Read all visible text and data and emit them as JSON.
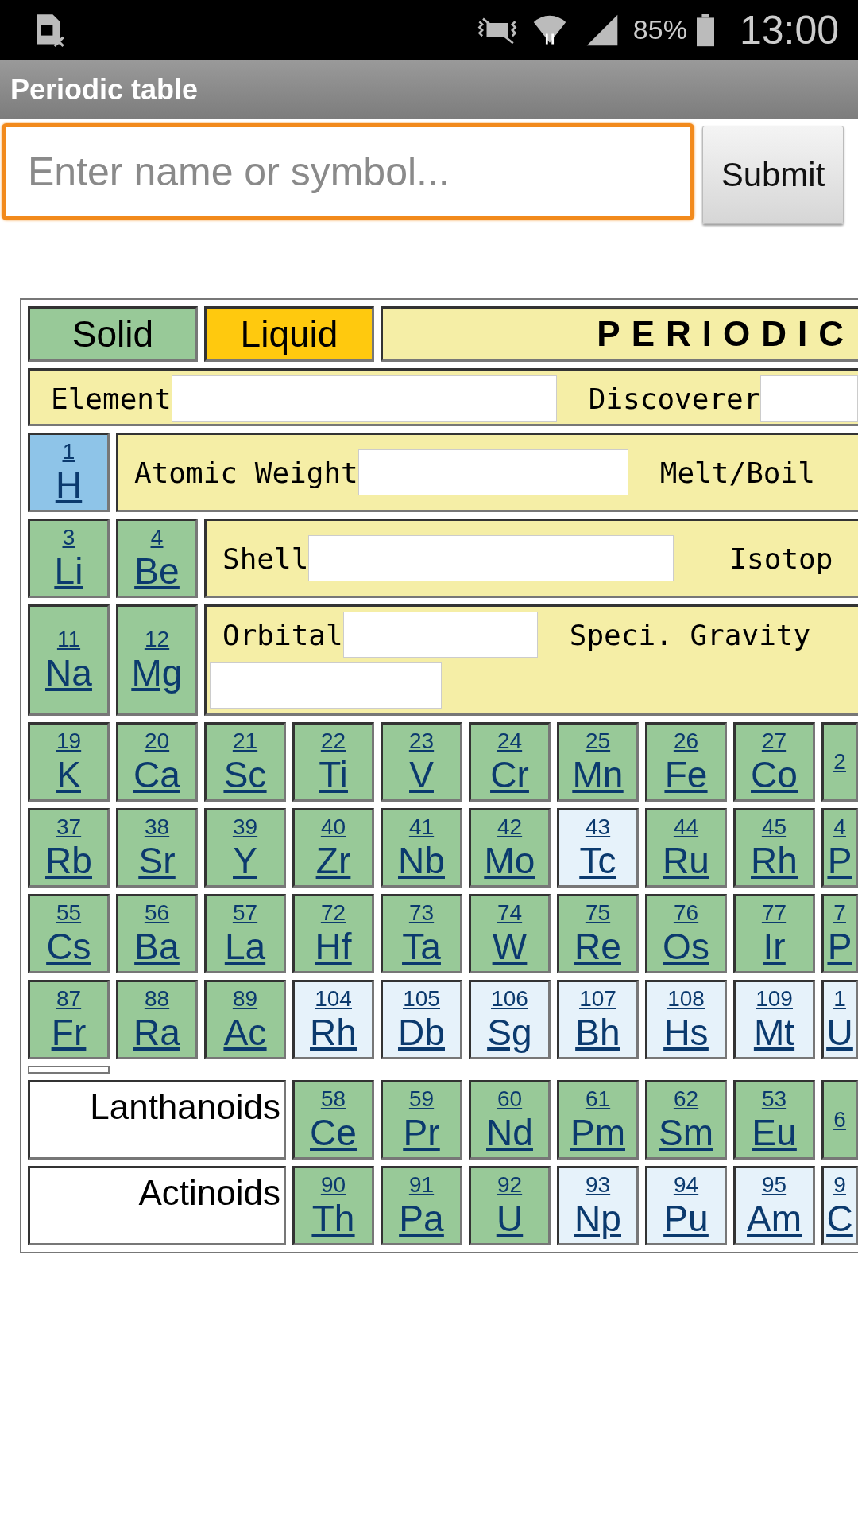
{
  "status_bar": {
    "battery": "85%",
    "time": "13:00"
  },
  "app_bar": {
    "title": "Periodic table"
  },
  "search": {
    "placeholder": "Enter name or symbol...",
    "focused": true,
    "button": "Submit"
  },
  "legend": [
    {
      "label": "Solid",
      "color": "#98c998"
    },
    {
      "label": "Liquid",
      "color": "#ffc90e"
    }
  ],
  "title": "PERIODIC",
  "top_rows": [
    {
      "elements": [],
      "panel": [
        {
          "kind": "label",
          "text": "Element"
        },
        {
          "kind": "field"
        },
        {
          "kind": "label",
          "text": "Discoverer"
        },
        {
          "kind": "field"
        }
      ]
    },
    {
      "elements": [
        {
          "number": "1",
          "symbol": "H",
          "color": "#8ec4e8"
        }
      ],
      "panel": [
        {
          "kind": "label",
          "text": "Atomic Weight"
        },
        {
          "kind": "field"
        },
        {
          "kind": "label",
          "text": "Melt/Boil"
        }
      ]
    },
    {
      "elements": [
        {
          "number": "3",
          "symbol": "Li",
          "color": "#98c998"
        },
        {
          "number": "4",
          "symbol": "Be",
          "color": "#98c998"
        }
      ],
      "panel": [
        {
          "kind": "label",
          "text": "Shell"
        },
        {
          "kind": "field"
        },
        {
          "kind": "label",
          "text": "Isotop"
        }
      ]
    },
    {
      "elements": [
        {
          "number": "11",
          "symbol": "Na",
          "color": "#98c998"
        },
        {
          "number": "12",
          "symbol": "Mg",
          "color": "#98c998"
        }
      ],
      "panel": [
        {
          "kind": "label",
          "text": "Orbital"
        },
        {
          "kind": "field"
        },
        {
          "kind": "label",
          "text": "Speci. Gravity"
        },
        {
          "kind": "field"
        }
      ]
    }
  ],
  "element_rows": [
    [
      {
        "number": "19",
        "symbol": "K",
        "color": "#98c998"
      },
      {
        "number": "20",
        "symbol": "Ca",
        "color": "#98c998"
      },
      {
        "number": "21",
        "symbol": "Sc",
        "color": "#98c998"
      },
      {
        "number": "22",
        "symbol": "Ti",
        "color": "#98c998"
      },
      {
        "number": "23",
        "symbol": "V",
        "color": "#98c998"
      },
      {
        "number": "24",
        "symbol": "Cr",
        "color": "#98c998"
      },
      {
        "number": "25",
        "symbol": "Mn",
        "color": "#98c998"
      },
      {
        "number": "26",
        "symbol": "Fe",
        "color": "#98c998"
      },
      {
        "number": "27",
        "symbol": "Co",
        "color": "#98c998"
      },
      {
        "number": "2",
        "color": "#98c998"
      }
    ],
    [
      {
        "number": "37",
        "symbol": "Rb",
        "color": "#98c998"
      },
      {
        "number": "38",
        "symbol": "Sr",
        "color": "#98c998"
      },
      {
        "number": "39",
        "symbol": "Y",
        "color": "#98c998"
      },
      {
        "number": "40",
        "symbol": "Zr",
        "color": "#98c998"
      },
      {
        "number": "41",
        "symbol": "Nb",
        "color": "#98c998"
      },
      {
        "number": "42",
        "symbol": "Mo",
        "color": "#98c998"
      },
      {
        "number": "43",
        "symbol": "Tc",
        "color": "#e6f2fa"
      },
      {
        "number": "44",
        "symbol": "Ru",
        "color": "#98c998"
      },
      {
        "number": "45",
        "symbol": "Rh",
        "color": "#98c998"
      },
      {
        "number": "4",
        "symbol": "P",
        "color": "#98c998"
      }
    ],
    [
      {
        "number": "55",
        "symbol": "Cs",
        "color": "#98c998"
      },
      {
        "number": "56",
        "symbol": "Ba",
        "color": "#98c998"
      },
      {
        "number": "57",
        "symbol": "La",
        "color": "#98c998"
      },
      {
        "number": "72",
        "symbol": "Hf",
        "color": "#98c998"
      },
      {
        "number": "73",
        "symbol": "Ta",
        "color": "#98c998"
      },
      {
        "number": "74",
        "symbol": "W",
        "color": "#98c998"
      },
      {
        "number": "75",
        "symbol": "Re",
        "color": "#98c998"
      },
      {
        "number": "76",
        "symbol": "Os",
        "color": "#98c998"
      },
      {
        "number": "77",
        "symbol": "Ir",
        "color": "#98c998"
      },
      {
        "number": "7",
        "symbol": "P",
        "color": "#98c998"
      }
    ],
    [
      {
        "number": "87",
        "symbol": "Fr",
        "color": "#98c998"
      },
      {
        "number": "88",
        "symbol": "Ra",
        "color": "#98c998"
      },
      {
        "number": "89",
        "symbol": "Ac",
        "color": "#98c998"
      },
      {
        "number": "104",
        "symbol": "Rh",
        "color": "#e6f2fa"
      },
      {
        "number": "105",
        "symbol": "Db",
        "color": "#e6f2fa"
      },
      {
        "number": "106",
        "symbol": "Sg",
        "color": "#e6f2fa"
      },
      {
        "number": "107",
        "symbol": "Bh",
        "color": "#e6f2fa"
      },
      {
        "number": "108",
        "symbol": "Hs",
        "color": "#e6f2fa"
      },
      {
        "number": "109",
        "symbol": "Mt",
        "color": "#e6f2fa"
      },
      {
        "number": "1",
        "symbol": "U",
        "color": "#e6f2fa"
      }
    ]
  ],
  "series_rows": [
    {
      "label": "Lanthanoids",
      "elements": [
        {
          "number": "58",
          "symbol": "Ce",
          "color": "#98c998"
        },
        {
          "number": "59",
          "symbol": "Pr",
          "color": "#98c998"
        },
        {
          "number": "60",
          "symbol": "Nd",
          "color": "#98c998"
        },
        {
          "number": "61",
          "symbol": "Pm",
          "color": "#98c998"
        },
        {
          "number": "62",
          "symbol": "Sm",
          "color": "#98c998"
        },
        {
          "number": "53",
          "symbol": "Eu",
          "color": "#98c998"
        },
        {
          "number": "6",
          "color": "#98c998"
        }
      ]
    },
    {
      "label": "Actinoids",
      "elements": [
        {
          "number": "90",
          "symbol": "Th",
          "color": "#98c998"
        },
        {
          "number": "91",
          "symbol": "Pa",
          "color": "#98c998"
        },
        {
          "number": "92",
          "symbol": "U",
          "color": "#98c998"
        },
        {
          "number": "93",
          "symbol": "Np",
          "color": "#e6f2fa"
        },
        {
          "number": "94",
          "symbol": "Pu",
          "color": "#e6f2fa"
        },
        {
          "number": "95",
          "symbol": "Am",
          "color": "#e6f2fa"
        },
        {
          "number": "9",
          "symbol": "C",
          "color": "#e6f2fa"
        }
      ]
    }
  ]
}
